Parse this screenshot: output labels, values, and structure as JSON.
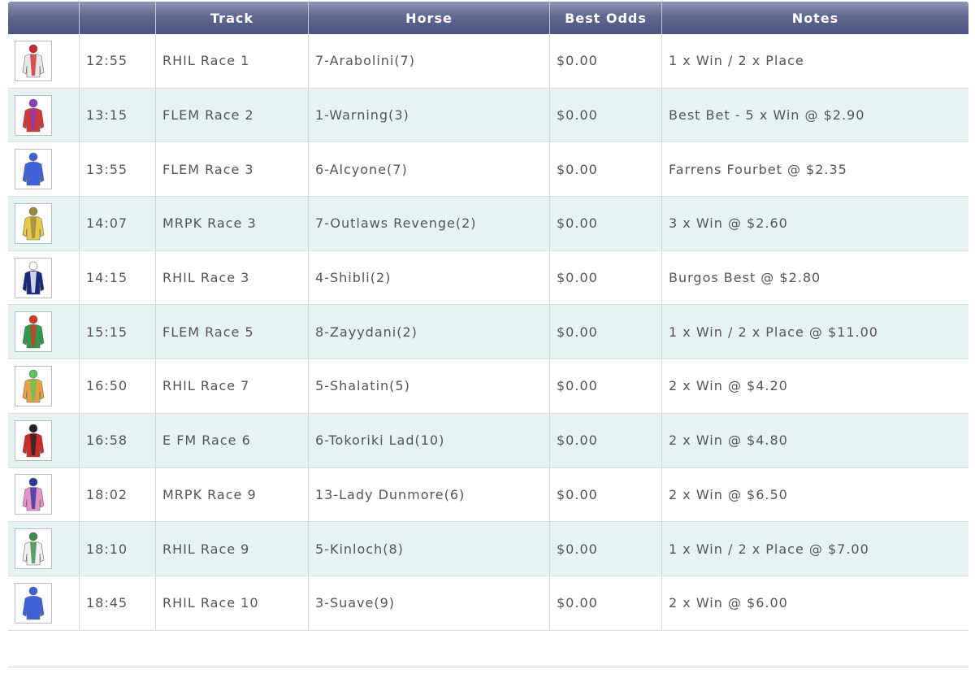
{
  "header": {
    "track": "Track",
    "horse": "Horse",
    "best_odds": "Best Odds",
    "notes": "Notes"
  },
  "rows": [
    {
      "time": "12:55",
      "track": "RHIL Race 1",
      "horse": "7-Arabolini(7)",
      "odds": "$0.00",
      "notes": "1 x Win / 2 x Place",
      "silk_icon": "silk-white-red-cross",
      "silk_colors": [
        "#e8e8e8",
        "#cc2a2a"
      ]
    },
    {
      "time": "13:15",
      "track": "FLEM Race 2",
      "horse": "1-Warning(3)",
      "odds": "$0.00",
      "notes": "Best Bet - 5 x Win @ $2.90",
      "silk_icon": "silk-red-purple",
      "silk_colors": [
        "#d23838",
        "#8a3fb8"
      ]
    },
    {
      "time": "13:55",
      "track": "FLEM Race 3",
      "horse": "6-Alcyone(7)",
      "odds": "$0.00",
      "notes": "Farrens Fourbet @ $2.35",
      "silk_icon": "silk-royal-blue",
      "silk_colors": [
        "#3f63d6",
        "#3f63d6"
      ]
    },
    {
      "time": "14:07",
      "track": "MRPK Race 3",
      "horse": "7-Outlaws Revenge(2)",
      "odds": "$0.00",
      "notes": "3 x Win @ $2.60",
      "silk_icon": "silk-yellow",
      "silk_colors": [
        "#e8c84a",
        "#9a8a3a"
      ]
    },
    {
      "time": "14:15",
      "track": "RHIL Race 3",
      "horse": "4-Shibli(2)",
      "odds": "$0.00",
      "notes": "Burgos Best @ $2.80",
      "silk_icon": "silk-navy-white",
      "silk_colors": [
        "#1a2a7a",
        "#ffffff"
      ]
    },
    {
      "time": "15:15",
      "track": "FLEM Race 5",
      "horse": "8-Zayydani(2)",
      "odds": "$0.00",
      "notes": "1 x Win / 2 x Place @ $11.00",
      "silk_icon": "silk-green-red",
      "silk_colors": [
        "#2f9a4a",
        "#d23a2a"
      ]
    },
    {
      "time": "16:50",
      "track": "RHIL Race 7",
      "horse": "5-Shalatin(5)",
      "odds": "$0.00",
      "notes": "2 x Win @ $4.20",
      "silk_icon": "silk-orange-green",
      "silk_colors": [
        "#e8a040",
        "#5ac85a"
      ]
    },
    {
      "time": "16:58",
      "track": "E FM Race 6",
      "horse": "6-Tokoriki Lad(10)",
      "odds": "$0.00",
      "notes": "2 x Win @ $4.80",
      "silk_icon": "silk-red-black-hoops",
      "silk_colors": [
        "#cc2a2a",
        "#222222"
      ]
    },
    {
      "time": "18:02",
      "track": "MRPK Race 9",
      "horse": "13-Lady Dunmore(6)",
      "odds": "$0.00",
      "notes": "2 x Win @ $6.50",
      "silk_icon": "silk-pink-blue",
      "silk_colors": [
        "#e890c8",
        "#2a3a9a"
      ]
    },
    {
      "time": "18:10",
      "track": "RHIL Race 9",
      "horse": "5-Kinloch(8)",
      "odds": "$0.00",
      "notes": "1 x Win / 2 x Place @ $7.00",
      "silk_icon": "silk-white-green",
      "silk_colors": [
        "#f0f0f0",
        "#3a8a4a"
      ]
    },
    {
      "time": "18:45",
      "track": "RHIL Race 10",
      "horse": "3-Suave(9)",
      "odds": "$0.00",
      "notes": "2 x Win @ $6.00",
      "silk_icon": "silk-royal-blue",
      "silk_colors": [
        "#3f63d6",
        "#3f63d6"
      ]
    }
  ]
}
